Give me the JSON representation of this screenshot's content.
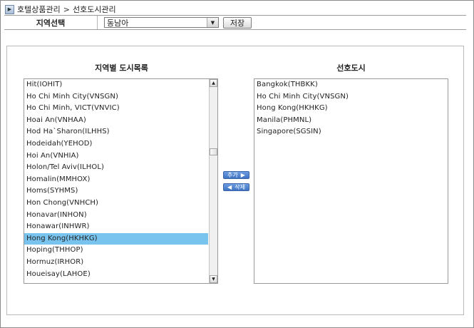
{
  "breadcrumb": {
    "icon": "arrow-icon",
    "section": "호텔상품관리",
    "separator": ">",
    "page": "선호도시관리"
  },
  "region": {
    "label": "지역선택",
    "selected": "동남아",
    "save_label": "저장"
  },
  "left_list": {
    "title": "지역별 도시목록",
    "items": [
      "Hit(IOHIT)",
      "Ho Chi Minh City(VNSGN)",
      "Ho Chi Minh, VICT(VNVIC)",
      "Hoai An(VNHAA)",
      "Hod Ha`Sharon(ILHHS)",
      "Hodeidah(YEHOD)",
      "Hoi An(VNHIA)",
      "Holon/Tel Aviv(ILHOL)",
      "Homalin(MMHOX)",
      "Homs(SYHMS)",
      "Hon Chong(VNHCH)",
      "Honavar(INHON)",
      "Honawar(INHWR)",
      "Hong Kong(HKHKG)",
      "Hoping(THHOP)",
      "Hormuz(IRHOR)",
      "Houeisay(LAHOE)"
    ],
    "selected_index": 13
  },
  "buttons": {
    "add_label": "추가",
    "delete_label": "삭제"
  },
  "right_list": {
    "title": "선호도시",
    "items": [
      "Bangkok(THBKK)",
      "Ho Chi Minh City(VNSGN)",
      "Hong Kong(HKHKG)",
      "Manila(PHMNL)",
      "Singapore(SGSIN)"
    ]
  },
  "colors": {
    "selection": "#79c4ef",
    "button_blue": "#4a7ecb"
  }
}
